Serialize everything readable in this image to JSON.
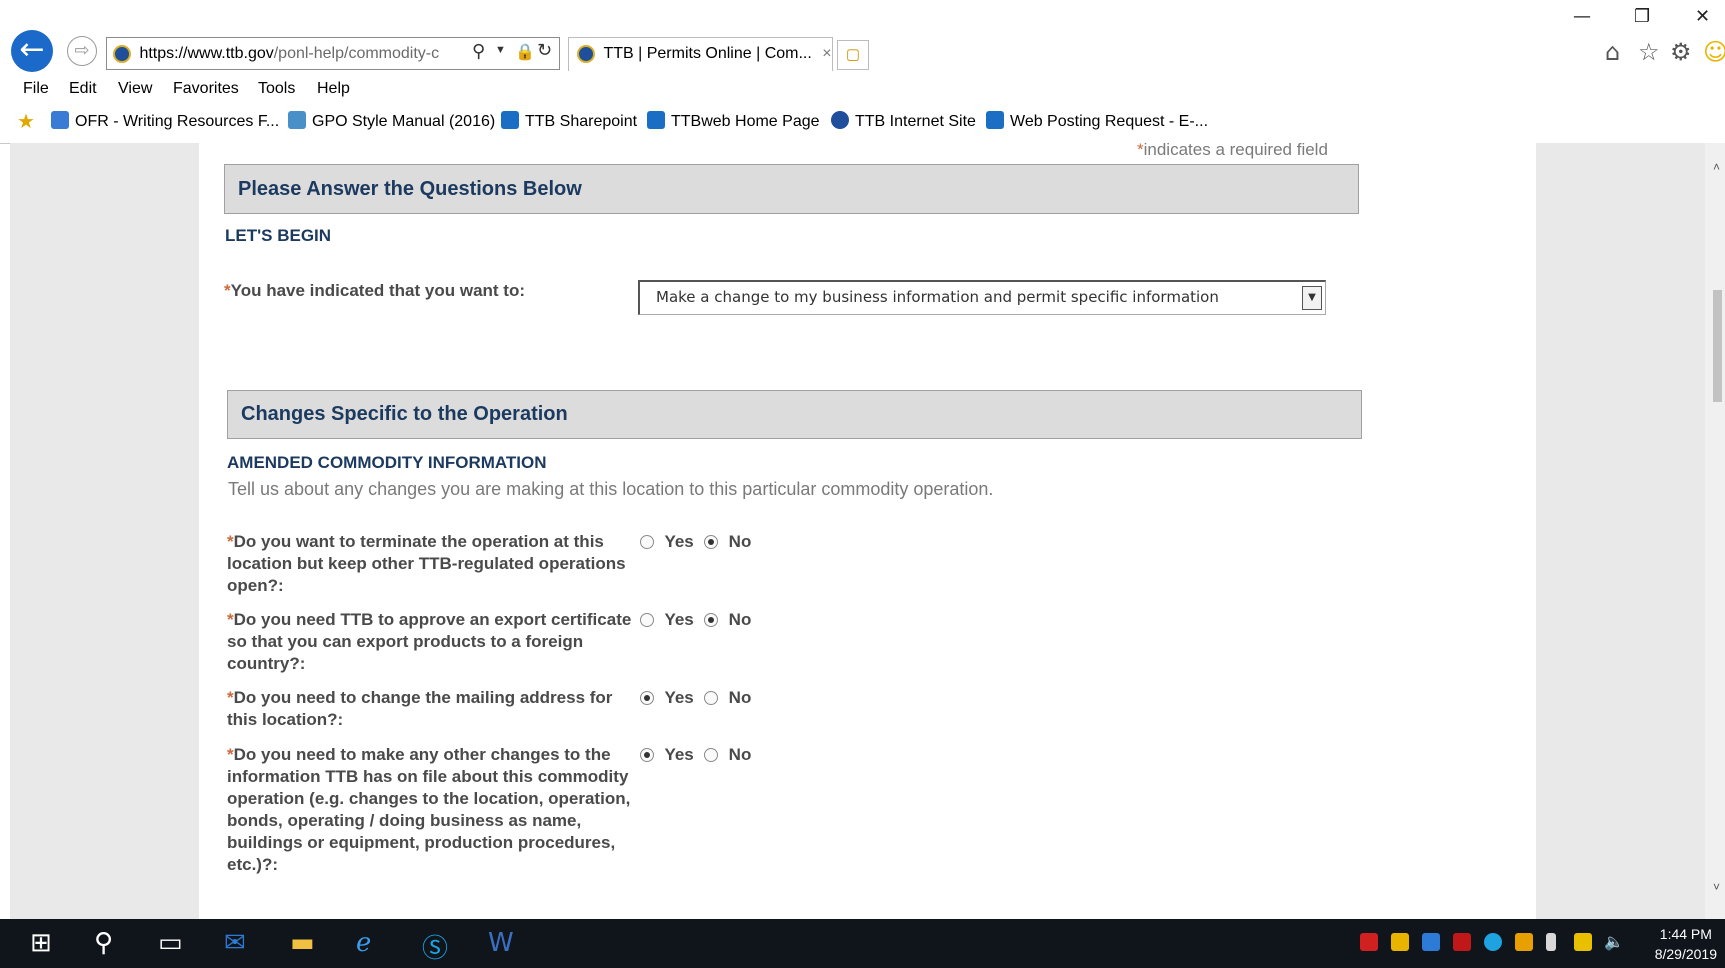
{
  "browser": {
    "url_host": "https://www.ttb.gov",
    "url_path": "/ponl-help/commodity-c",
    "tab_title": "TTB | Permits Online | Com...",
    "tab_close": "×",
    "menu": [
      "File",
      "Edit",
      "View",
      "Favorites",
      "Tools",
      "Help"
    ],
    "favorites": [
      {
        "label": "OFR - Writing Resources F...",
        "icon": "ofr-icon",
        "color": "#3a7bd5"
      },
      {
        "label": "GPO Style Manual (2016)",
        "icon": "gpo-icon",
        "color": "#4a90c8"
      },
      {
        "label": "TTB Sharepoint",
        "icon": "sharepoint-icon",
        "color": "#1a6fc4"
      },
      {
        "label": "TTBweb Home Page",
        "icon": "sharepoint-icon",
        "color": "#1a6fc4"
      },
      {
        "label": "TTB Internet Site",
        "icon": "ttb-shield-icon",
        "color": "#1f4e9a"
      },
      {
        "label": "Web Posting Request - E-...",
        "icon": "sharepoint-icon",
        "color": "#1a6fc4"
      }
    ]
  },
  "page": {
    "required_star": "*",
    "required_note": "indicates a required field",
    "section1": {
      "title": "Please Answer the Questions Below",
      "subtitle": "LET'S BEGIN",
      "question": "You have indicated that you want to:",
      "select_value": "Make a change to my business information and permit specific information"
    },
    "section2": {
      "title": "Changes Specific to the Operation",
      "subtitle": "AMENDED COMMODITY INFORMATION",
      "description": "Tell us about any changes you are making at this location to this particular commodity operation.",
      "questions": [
        {
          "text": "Do you want to terminate the operation at this location but keep other TTB-regulated operations open?:",
          "selected": "No"
        },
        {
          "text": "Do you need TTB to approve an export certificate so that you can export products to a foreign country?:",
          "selected": "No"
        },
        {
          "text": "Do you need to change the mailing address for this location?:",
          "selected": "Yes"
        },
        {
          "text": "Do you need to make any other changes to the information TTB has on file about this commodity operation (e.g. changes to the location, operation, bonds, operating / doing business as name, buildings or equipment, production procedures, etc.)?:",
          "selected": "Yes"
        }
      ],
      "yes_label": "Yes",
      "no_label": "No"
    }
  },
  "taskbar": {
    "time": "1:44 PM",
    "date": "8/29/2019"
  }
}
